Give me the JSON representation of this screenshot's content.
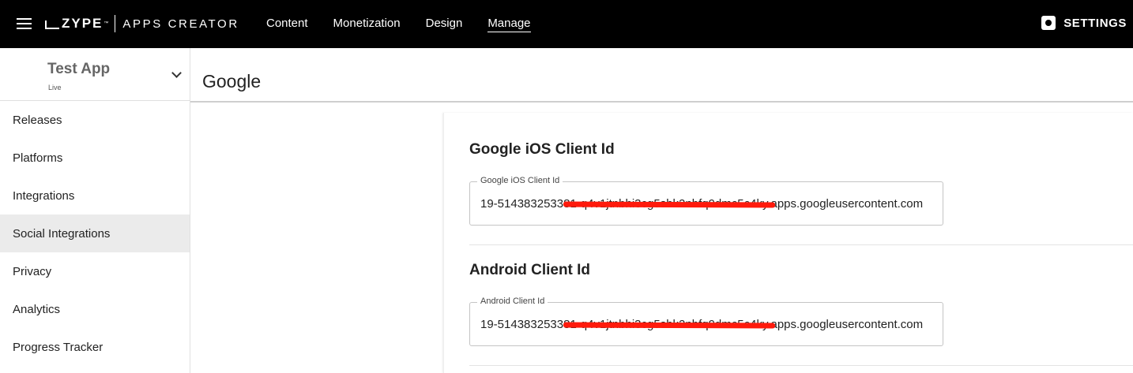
{
  "header": {
    "brand": "ZYPE",
    "trademark": "™",
    "product": "APPS CREATOR",
    "nav": [
      {
        "label": "Content"
      },
      {
        "label": "Monetization"
      },
      {
        "label": "Design"
      },
      {
        "label": "Manage"
      }
    ],
    "active_nav": "Manage",
    "settings_label": "SETTINGS"
  },
  "sidebar": {
    "app_name": "Test App",
    "app_status": "Live",
    "items": [
      {
        "label": "Releases"
      },
      {
        "label": "Platforms"
      },
      {
        "label": "Integrations"
      },
      {
        "label": "Social Integrations"
      },
      {
        "label": "Privacy"
      },
      {
        "label": "Analytics"
      },
      {
        "label": "Progress Tracker"
      }
    ],
    "active_item": "Social Integrations"
  },
  "main": {
    "page_title": "Google",
    "sections": [
      {
        "title": "Google iOS Client Id",
        "field_label": "Google iOS Client Id",
        "field_value": "19-514383253381-q4v1jtnbhi3cg5sbk2nbfq9dmc5c4ky.apps.googleusercontent.com"
      },
      {
        "title": "Android Client Id",
        "field_label": "Android Client Id",
        "field_value": "19-514383253381-q4v1jtnbhi3cg5sbk2nbfq9dmc5c4ky.apps.googleusercontent.com"
      }
    ]
  },
  "colors": {
    "topbar": "#000000",
    "active_sidebar": "#ebebeb",
    "redaction": "#ff1a0c"
  }
}
